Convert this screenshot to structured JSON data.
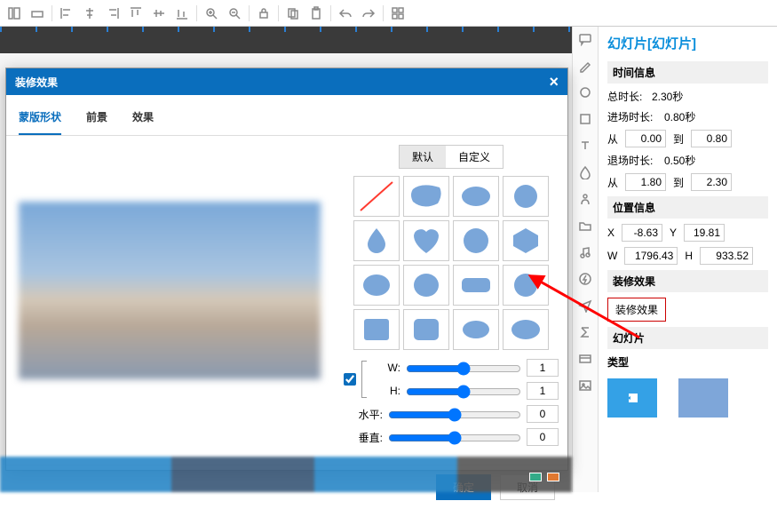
{
  "modal": {
    "title": "装修效果",
    "tabs": [
      "蒙版形状",
      "前景",
      "效果"
    ],
    "sub_tabs": {
      "default": "默认",
      "custom": "自定义"
    },
    "sliders": {
      "w_label": "W:",
      "h_label": "H:",
      "hor_label": "水平:",
      "ver_label": "垂直:",
      "w_val": "1",
      "h_val": "1",
      "hor_val": "0",
      "ver_val": "0"
    },
    "buttons": {
      "ok": "确定",
      "cancel": "取消"
    }
  },
  "props": {
    "title": "幻灯片[幻灯片]",
    "time_section": "时间信息",
    "total_label": "总时长:",
    "total_val": "2.30秒",
    "enter_label": "进场时长:",
    "enter_val": "0.80秒",
    "from_label": "从",
    "to_label": "到",
    "enter_from": "0.00",
    "enter_to": "0.80",
    "exit_label": "退场时长:",
    "exit_val": "0.50秒",
    "exit_from": "1.80",
    "exit_to": "2.30",
    "pos_section": "位置信息",
    "x_label": "X",
    "x_val": "-8.63",
    "y_label": "Y",
    "y_val": "19.81",
    "w_label": "W",
    "w_val": "1796.43",
    "h_label": "H",
    "h_val": "933.52",
    "deco_section": "装修效果",
    "deco_btn": "装修效果",
    "slide_section": "幻灯片",
    "type_label": "类型"
  }
}
